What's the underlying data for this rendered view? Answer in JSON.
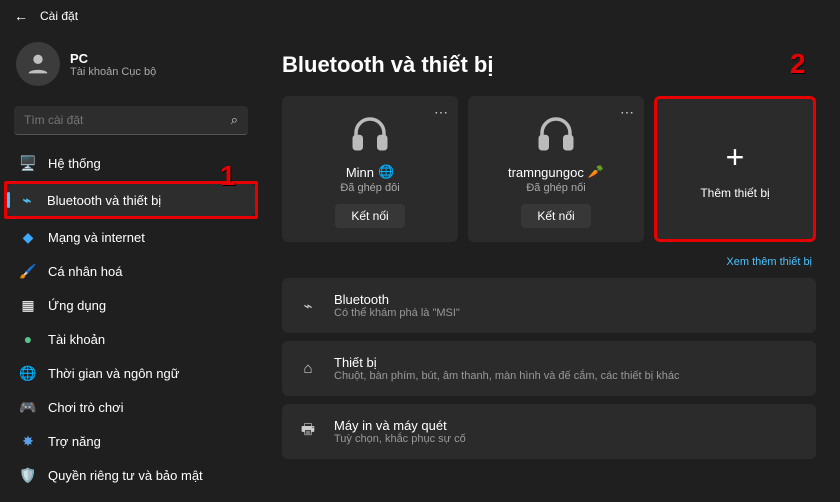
{
  "topbar": {
    "title": "Cài đặt"
  },
  "profile": {
    "name": "PC",
    "subtitle": "Tài khoản Cục bộ"
  },
  "search": {
    "placeholder": "Tìm cài đặt"
  },
  "sidebar": {
    "items": [
      {
        "label": "Hệ thống",
        "icon": "🖥️"
      },
      {
        "label": "Bluetooth và thiết bị",
        "icon": "bt"
      },
      {
        "label": "Mạng và internet",
        "icon": "📡"
      },
      {
        "label": "Cá nhân hoá",
        "icon": "🖌️"
      },
      {
        "label": "Ứng dụng",
        "icon": "▦"
      },
      {
        "label": "Tài khoản",
        "icon": "👤"
      },
      {
        "label": "Thời gian và ngôn ngữ",
        "icon": "🌐"
      },
      {
        "label": "Chơi trò chơi",
        "icon": "🎮"
      },
      {
        "label": "Trợ năng",
        "icon": "♿"
      },
      {
        "label": "Quyền riêng tư và bảo mật",
        "icon": "🛡️"
      }
    ],
    "active_index": 1
  },
  "main": {
    "title": "Bluetooth và thiết bị",
    "devices": [
      {
        "name": "Minn",
        "badge": "🌐",
        "status": "Đã ghép đôi",
        "button": "Kết nối"
      },
      {
        "name": "tramngungoc",
        "badge": "🥕",
        "status": "Đã ghép nối",
        "button": "Kết nối"
      }
    ],
    "add_device_label": "Thêm thiết bị",
    "more_devices_link": "Xem thêm thiết bị",
    "rows": [
      {
        "icon": "bt",
        "title": "Bluetooth",
        "sub": "Có thể khám phá là \"MSI\""
      },
      {
        "icon": "📱",
        "title": "Thiết bị",
        "sub": "Chuột, bàn phím, bút, âm thanh, màn hình và đế cắm, các thiết bị khác"
      },
      {
        "icon": "🖨️",
        "title": "Máy in và máy quét",
        "sub": "Tuỳ chọn, khắc phục sự cố"
      }
    ]
  },
  "annotations": {
    "one": "1",
    "two": "2"
  },
  "colors": {
    "accent": "#4cc2ff",
    "alert": "#e60000"
  }
}
